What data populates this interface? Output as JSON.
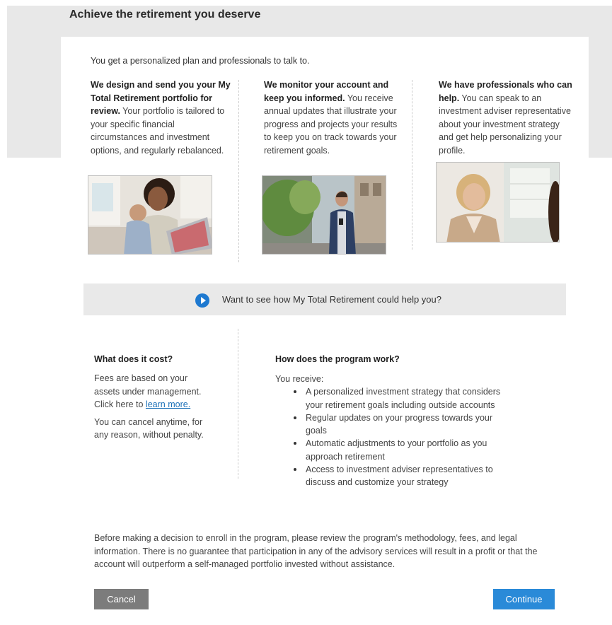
{
  "page": {
    "title": "Achieve the retirement you deserve"
  },
  "intro": "You get a personalized plan and professionals to talk to.",
  "columns": [
    {
      "heading": "We design and send you your My Total Retirement portfolio for review.",
      "body": " Your portfolio is tailored to your specific financial circumstances and investment options, and regularly rebalanced."
    },
    {
      "heading": "We monitor your account and keep you informed.",
      "body": " You receive annual updates that illustrate your progress and projects your results to keep you on track towards your retirement goals."
    },
    {
      "heading": "We have professionals who can help.",
      "body": " You can speak to an investment adviser representative about your investment strategy and get help personalizing your profile."
    }
  ],
  "video": {
    "label": "Want to see how My Total Retirement could help you?",
    "icon": "play-icon"
  },
  "cost": {
    "heading": "What does it cost?",
    "text_before_link": "Fees are based on your assets under management. Click here to ",
    "link": "learn more.",
    "cancel_note": "You can cancel anytime, for any reason, without penalty."
  },
  "how": {
    "heading": "How does the program work?",
    "lead": "You receive:",
    "items": [
      "A personalized investment strategy that considers your retirement goals including outside accounts",
      "Regular updates on your progress towards your goals",
      "Automatic adjustments to your portfolio as you approach retirement",
      "Access to investment adviser representatives to discuss and customize your strategy"
    ]
  },
  "disclaimer": "Before making a decision to enroll in the program, please review the program's methodology, fees, and legal information. There is no guarantee that participation in any of the advisory services will result in a profit or that the account will outperform a self-managed portfolio invested without assistance.",
  "buttons": {
    "cancel": "Cancel",
    "continue": "Continue"
  },
  "colors": {
    "accent": "#2a8ad8",
    "cancel": "#7c7c7c",
    "link": "#1a6fb7",
    "band": "#e8e8e8"
  }
}
